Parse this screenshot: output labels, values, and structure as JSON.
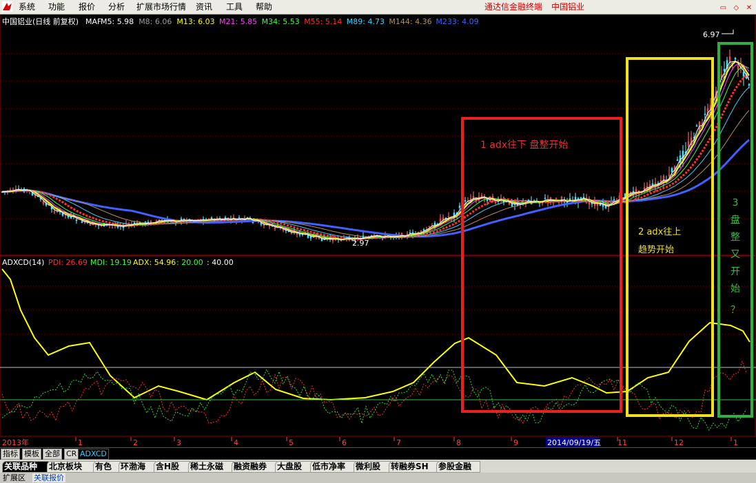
{
  "menu": {
    "items": [
      "系统",
      "功能",
      "报价",
      "分析",
      "扩展市场行情",
      "资讯",
      "工具",
      "帮助"
    ],
    "app_title": "通达信金融终端",
    "stock_title": "中国铝业"
  },
  "price_panel": {
    "stock_label": "中国铝业(日线 前复权)",
    "indicator": "MAF",
    "ma": [
      {
        "name": "M5",
        "value": "5.98",
        "color": "#ffffff"
      },
      {
        "name": "M8",
        "value": "6.06",
        "color": "#9a9a9a"
      },
      {
        "name": "M13",
        "value": "6.03",
        "color": "#ffff00"
      },
      {
        "name": "M21",
        "value": "5.85",
        "color": "#ff40ff"
      },
      {
        "name": "M34",
        "value": "5.53",
        "color": "#40ff40"
      },
      {
        "name": "M55",
        "value": "5.14",
        "color": "#ff3030"
      },
      {
        "name": "M89",
        "value": "4.73",
        "color": "#40d0ff"
      },
      {
        "name": "M144",
        "value": "4.36",
        "color": "#b09060"
      },
      {
        "name": "M233",
        "value": "4.09",
        "color": "#4060ff"
      }
    ],
    "high_label": "6.97",
    "low_label": "2.97"
  },
  "adx_panel": {
    "label": "ADXCD(14)",
    "pdi_label": "PDI: 26.69",
    "mdi_label": "MDI: 19.19",
    "adx_label": "ADX: 54.96",
    "level_1": ": 20.00",
    "level_2": ": 40.00"
  },
  "chart_data": {
    "type": "line",
    "title": "中国铝业(日线 前复权)",
    "x_ticks": [
      "2013年",
      "1",
      "2",
      "3",
      "4",
      "5",
      "6",
      "7",
      "8",
      "9",
      "2014/09/19/五",
      "11",
      "12",
      "1"
    ],
    "price_labels": {
      "high": 6.97,
      "low": 2.97
    },
    "ma_values": {
      "M5": 5.98,
      "M8": 6.06,
      "M13": 6.03,
      "M21": 5.85,
      "M34": 5.53,
      "M55": 5.14,
      "M89": 4.73,
      "M144": 4.36,
      "M233": 4.09
    },
    "adx_values": {
      "PDI": 26.69,
      "MDI": 19.19,
      "ADX": 54.96
    },
    "adx_levels": [
      20,
      40
    ],
    "grid": true
  },
  "annotations": {
    "box1_text": "1 adx往下 盘整开始",
    "box2_line1": "2 adx往上",
    "box2_line2": "趋势开始",
    "box3_chars": [
      "3",
      "盘",
      "整",
      "又",
      "开",
      "始",
      "？"
    ],
    "box1_color": "#e82020",
    "box2_color": "#f0e020",
    "box3_color": "#30b040"
  },
  "tabs": {
    "items": [
      "指标",
      "模板",
      "全部",
      "CR",
      "ADXCD"
    ]
  },
  "blocks": {
    "items": [
      "关联品种",
      "北京板块",
      "有色",
      "环渤海",
      "含H股",
      "稀土永磁",
      "融资融券",
      "大盘股",
      "低市净率",
      "微利股",
      "转融券SH",
      "参股金融"
    ]
  },
  "bottom": {
    "expand_label": "扩展区",
    "related_label": "关联报价"
  }
}
